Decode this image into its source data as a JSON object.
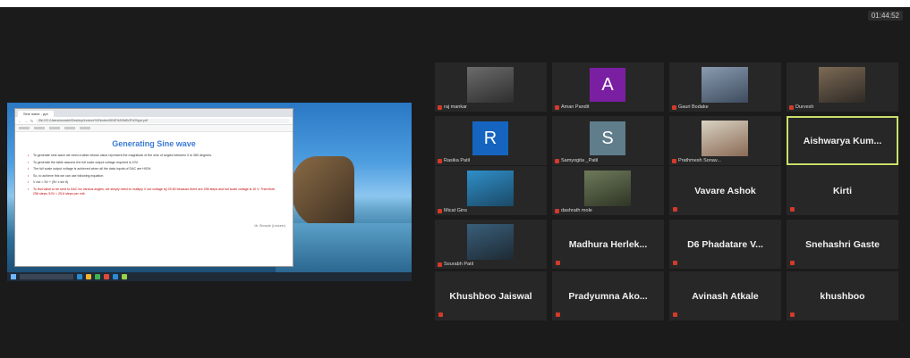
{
  "meeting": {
    "timer": "01:44:52"
  },
  "shared_screen": {
    "browser_tab": "Sine wave - ppt",
    "url": "file:///C:/Users/sourabh/Desktop/Lecture%20notes/SINE%20WAVE%20ppt.pdf",
    "slide_title": "Generating Sine wave",
    "bullets": [
      {
        "text": "To generate sine wave we need a table whose value represent the magnitude of the sine of angles between 0 to 360 degrees.",
        "red": false
      },
      {
        "text": "To generate the table assume the full scale output voltage required is 10V.",
        "red": false
      },
      {
        "text": "The full scale output voltage is achieved when all the data inputs of DAC are HIGH.",
        "red": false
      },
      {
        "text": "So, to achieve this we can use following equation",
        "red": false
      },
      {
        "text": "V out = 5V + (5V x sin θ)",
        "red": false
      },
      {
        "text": "To find value to be sent to DAC for various angles, we simply need to multiply V out voltage by 25.60 because there are 256 steps and full scale voltage is 10 V. Therefore, 256 steps /10V = 25.6 steps per volt.",
        "red": true
      }
    ],
    "footer": "Mr. Bhosale (Lecturer)"
  },
  "participants": [
    {
      "name": "raj mankar",
      "type": "photo",
      "muted": true
    },
    {
      "name": "Aman Pandit",
      "type": "avatar",
      "letter": "A",
      "color": "#7b1fa2",
      "muted": true
    },
    {
      "name": "Gauri Bodake",
      "type": "photo",
      "muted": true
    },
    {
      "name": "Durvesh",
      "type": "photo",
      "muted": true
    },
    {
      "name": "Rasika Patil",
      "type": "avatar",
      "letter": "R",
      "color": "#1565c0",
      "muted": true
    },
    {
      "name": "Samyogita _Patil",
      "type": "avatar",
      "letter": "S",
      "color": "#607d8b",
      "muted": true
    },
    {
      "name": "Prathmesh Sonav...",
      "type": "photo",
      "muted": true
    },
    {
      "name": "Aishwarya  Kum...",
      "type": "text",
      "muted": false,
      "active": true
    },
    {
      "name": "Micat Gins",
      "type": "photo",
      "muted": true
    },
    {
      "name": "dashrath mole",
      "type": "photo",
      "muted": true
    },
    {
      "name": "Vavare Ashok",
      "type": "text",
      "muted": true
    },
    {
      "name": "Kirti",
      "type": "text",
      "muted": true
    },
    {
      "name": "Sourabh Patil",
      "type": "photo",
      "muted": true
    },
    {
      "name": "Madhura  Herlek...",
      "type": "text",
      "muted": true
    },
    {
      "name": "D6 Phadatare V...",
      "type": "text",
      "muted": true
    },
    {
      "name": "Snehashri Gaste",
      "type": "text",
      "muted": true
    },
    {
      "name": "Khushboo Jaiswal",
      "type": "text",
      "muted": true
    },
    {
      "name": "Pradyumna  Ako...",
      "type": "text",
      "muted": true
    },
    {
      "name": "Avinash Atkale",
      "type": "text",
      "muted": true
    },
    {
      "name": "khushboo",
      "type": "text",
      "muted": true
    }
  ],
  "colors": {
    "active_border": "#c9e06a",
    "tile_bg": "#272727",
    "mic_muted": "#d23a2b"
  }
}
